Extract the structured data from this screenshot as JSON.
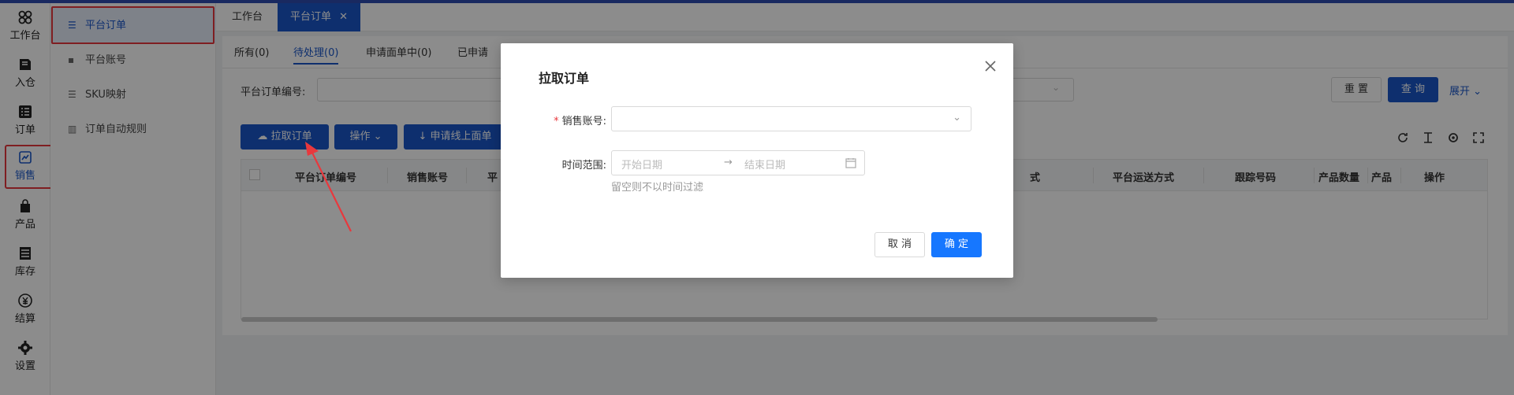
{
  "rail": {
    "items": [
      {
        "label": "工作台",
        "icon": "workbench-icon"
      },
      {
        "label": "入仓",
        "icon": "inbound-icon"
      },
      {
        "label": "订单",
        "icon": "order-icon"
      },
      {
        "label": "销售",
        "icon": "sales-icon"
      },
      {
        "label": "产品",
        "icon": "product-icon"
      },
      {
        "label": "库存",
        "icon": "inventory-icon"
      },
      {
        "label": "结算",
        "icon": "settlement-icon"
      },
      {
        "label": "设置",
        "icon": "settings-icon"
      }
    ]
  },
  "submenu": {
    "items": [
      {
        "label": "平台订单",
        "icon": "list-icon"
      },
      {
        "label": "平台账号",
        "icon": "account-icon"
      },
      {
        "label": "SKU映射",
        "icon": "list-icon"
      },
      {
        "label": "订单自动规则",
        "icon": "chart-icon"
      }
    ]
  },
  "tabs": {
    "items": [
      {
        "label": "工作台"
      },
      {
        "label": "平台订单"
      }
    ]
  },
  "subtabs": {
    "items": [
      {
        "label": "所有(0)"
      },
      {
        "label": "待处理(0)"
      },
      {
        "label": "申请面单中(0)"
      },
      {
        "label": "已申请"
      }
    ]
  },
  "filters": {
    "order_no_label": "平台订单编号:",
    "reset_label": "重 置",
    "search_label": "查 询",
    "expand_label": "展开"
  },
  "toolbar": {
    "pull_orders_label": "拉取订单",
    "operations_label": "操作",
    "apply_label": "申请线上面单"
  },
  "table": {
    "columns": [
      "平台订单编号",
      "销售账号",
      "平",
      "式",
      "平台运送方式",
      "跟踪号码",
      "产品数量",
      "产品",
      "操作"
    ]
  },
  "modal": {
    "title": "拉取订单",
    "account_label": "销售账号:",
    "account_required_mark": "*",
    "time_label": "时间范围:",
    "start_placeholder": "开始日期",
    "end_placeholder": "结束日期",
    "range_arrow": "→",
    "hint": "留空则不以时间过滤",
    "cancel_label": "取 消",
    "ok_label": "确 定"
  },
  "colors": {
    "primary": "#1a57c9",
    "modal_primary": "#1677ff",
    "highlight": "#e8383d"
  }
}
